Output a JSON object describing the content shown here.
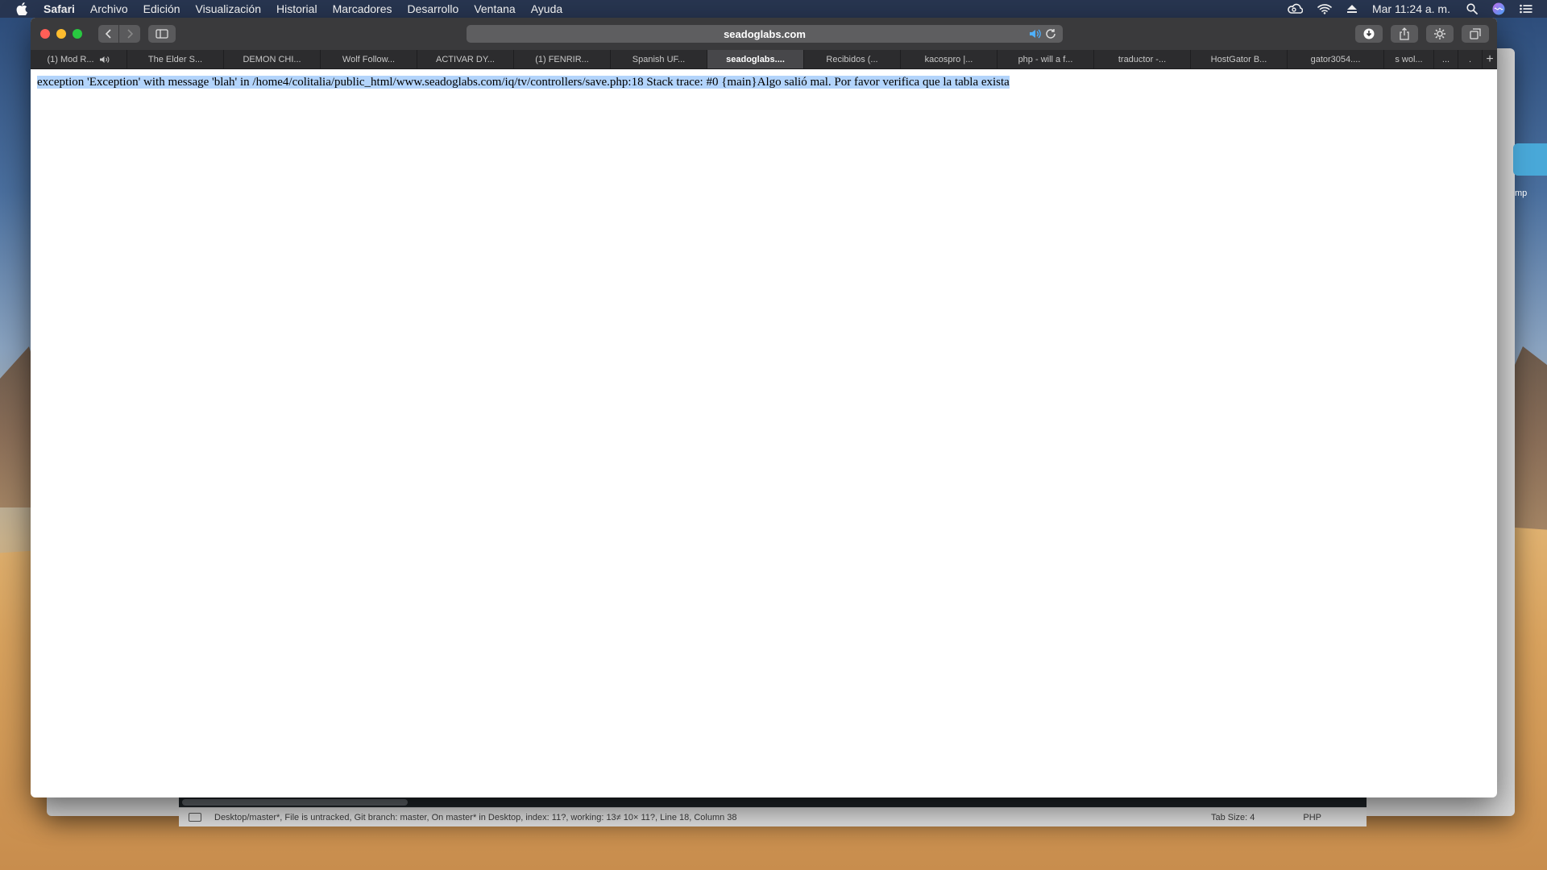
{
  "menubar": {
    "apple_icon": "apple-logo-icon",
    "items": [
      "Safari",
      "Archivo",
      "Edición",
      "Visualización",
      "Historial",
      "Marcadores",
      "Desarrollo",
      "Ventana",
      "Ayuda"
    ],
    "status_icons": [
      "creative-cloud-icon",
      "wifi-icon",
      "eject-icon"
    ],
    "clock": "Mar 11:24 a. m.",
    "right_icons": [
      "spotlight-search-icon",
      "siri-icon",
      "notification-center-icon"
    ]
  },
  "browser": {
    "address": "seadoglabs.com",
    "tabs": [
      {
        "label": "(1) Mod R...",
        "audio": true
      },
      {
        "label": "The Elder S..."
      },
      {
        "label": "DEMON CHI..."
      },
      {
        "label": "Wolf Follow..."
      },
      {
        "label": "ACTIVAR DY..."
      },
      {
        "label": "(1) FENRIR..."
      },
      {
        "label": "Spanish UF..."
      },
      {
        "label": "seadoglabs....",
        "active": true
      },
      {
        "label": "Recibidos (..."
      },
      {
        "label": "kacospro |..."
      },
      {
        "label": "php - will a f..."
      },
      {
        "label": "traductor -..."
      },
      {
        "label": "HostGator B..."
      },
      {
        "label": "gator3054...."
      },
      {
        "label": "s wol..."
      },
      {
        "label": "..."
      },
      {
        "label": "."
      }
    ],
    "new_tab_label": "+"
  },
  "page": {
    "error_message": "exception 'Exception' with message 'blah' in /home4/colitalia/public_html/www.seadoglabs.com/iq/tv/controllers/save.php:18 Stack trace: #0 {main}Algo salió mal. Por favor verifica que la tabla exista"
  },
  "editor": {
    "status_info": "Desktop/master*, File is untracked, Git branch: master, On master* in Desktop, index: 11?, working: 13≠ 10× 11?, Line 18, Column 38",
    "tab_size": "Tab Size: 4",
    "language": "PHP",
    "widget_text": "mp"
  },
  "colors": {
    "selection": "#b3d4fb",
    "toolbar": "#3a3a3c",
    "close": "#ff5f57",
    "minimize": "#febc2e",
    "maximize": "#28c840"
  }
}
